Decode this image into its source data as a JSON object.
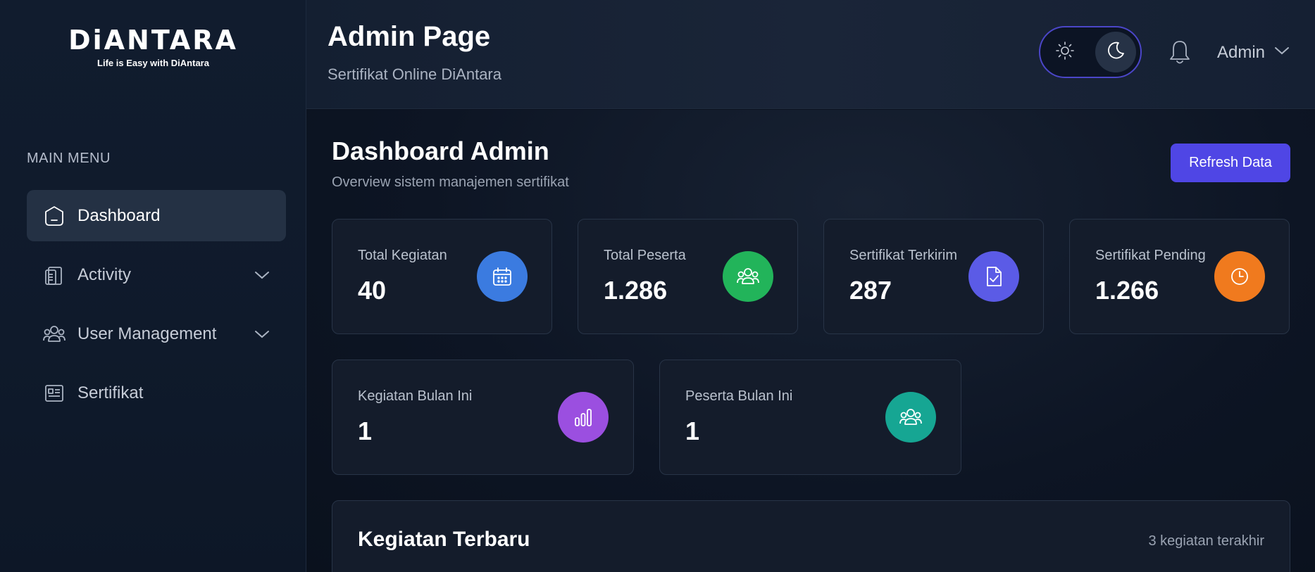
{
  "brand": {
    "logo_text": "DiANTARA",
    "tagline": "Life is Easy with DiAntara"
  },
  "sidebar": {
    "heading": "MAIN MENU",
    "items": [
      {
        "label": "Dashboard",
        "icon": "home-icon",
        "active": true
      },
      {
        "label": "Activity",
        "icon": "clipboard-icon",
        "expandable": true
      },
      {
        "label": "User Management",
        "icon": "users-icon",
        "expandable": true
      },
      {
        "label": "Sertifikat",
        "icon": "document-list-icon"
      }
    ]
  },
  "header": {
    "title": "Admin Page",
    "subtitle": "Sertifikat Online DiAntara",
    "theme_mode": "dark",
    "user": "Admin"
  },
  "dashboard": {
    "title": "Dashboard Admin",
    "subtitle": "Overview sistem manajemen sertifikat",
    "refresh_label": "Refresh Data",
    "stats": [
      {
        "label": "Total Kegiatan",
        "value": "40",
        "icon": "calendar-icon",
        "color": "#3b7be0"
      },
      {
        "label": "Total Peserta",
        "value": "1.286",
        "icon": "users-icon",
        "color": "#22b45a"
      },
      {
        "label": "Sertifikat Terkirim",
        "value": "287",
        "icon": "file-check-icon",
        "color": "#5b5be6"
      },
      {
        "label": "Sertifikat Pending",
        "value": "1.266",
        "icon": "clock-icon",
        "color": "#f07a1e"
      },
      {
        "label": "Kegiatan Bulan Ini",
        "value": "1",
        "icon": "bar-chart-icon",
        "color": "#9b4fe0"
      },
      {
        "label": "Peserta Bulan Ini",
        "value": "1",
        "icon": "users-icon",
        "color": "#16a693"
      }
    ],
    "recent": {
      "title": "Kegiatan Terbaru",
      "meta": "3 kegiatan terakhir"
    }
  },
  "colors": {
    "accent": "#4f46e5",
    "background": "#0b1220",
    "sidebar": "#111c2e",
    "card": "#141c2b"
  }
}
